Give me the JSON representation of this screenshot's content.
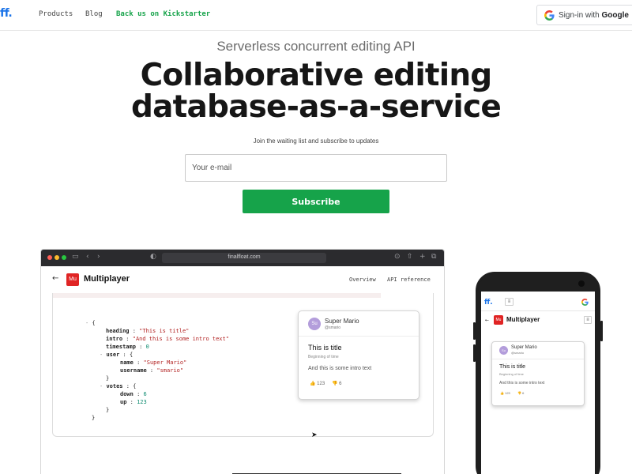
{
  "nav": {
    "logo": "ff.",
    "links": [
      "Products",
      "Blog",
      "Back us on Kickstarter"
    ],
    "signin_prefix": "Sign-in with ",
    "signin_brand": "Google"
  },
  "hero": {
    "kicker": "Serverless concurrent editing API",
    "headline_line1": "Collaborative editing",
    "headline_line2": "database-as-a-service",
    "join_text": "Join the waiting list and subscribe to updates",
    "email_placeholder": "Your e-mail",
    "subscribe_label": "Subscribe"
  },
  "browser": {
    "url": "finalfloat.com",
    "app_logo": "Mu",
    "app_title": "Multiplayer",
    "tabs": [
      "Overview",
      "API reference"
    ]
  },
  "code": {
    "l1": "{",
    "heading_key": "heading",
    "heading_val": "\"This is title\"",
    "intro_key": "intro",
    "intro_val": "\"And this is some intro text\"",
    "timestamp_key": "timestamp",
    "timestamp_val": "0",
    "user_key": "user",
    "name_key": "name",
    "name_val": "\"Super Mario\"",
    "username_key": "username",
    "username_val": "\"smario\"",
    "votes_key": "votes",
    "down_key": "down",
    "down_val": "6",
    "up_key": "up",
    "up_val": "123",
    "open_brace": "{",
    "close_brace": "}"
  },
  "card": {
    "avatar": "Su",
    "name": "Super Mario",
    "handle": "@smario",
    "title": "This is title",
    "subtitle": "Beginning of time",
    "intro": "And this is some intro text",
    "upvotes": "123",
    "downvotes": "6"
  },
  "phone": {
    "logo": "ff.",
    "app_logo": "Mu",
    "app_title": "Multiplayer",
    "menu_glyph": "≡"
  },
  "icons": {
    "thumb_up": "👍",
    "thumb_down": "👎",
    "back_arrow": "←",
    "cursor": "▲"
  },
  "colors": {
    "accent_green": "#16a34a",
    "brand_blue": "#1a73e8",
    "mu_red": "#e02424"
  }
}
